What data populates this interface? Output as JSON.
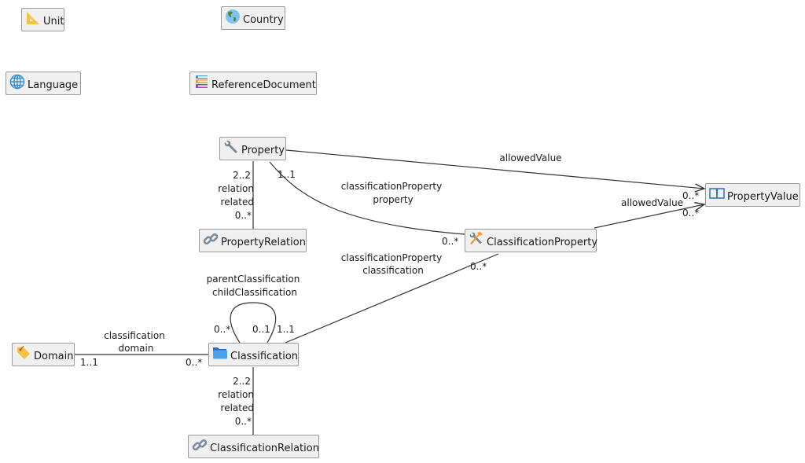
{
  "nodes": {
    "unit": {
      "label": "Unit",
      "icon": "triangle-ruler-icon"
    },
    "country": {
      "label": "Country",
      "icon": "globe-americas-icon"
    },
    "language": {
      "label": "Language",
      "icon": "globe-grid-icon"
    },
    "reference_document": {
      "label": "ReferenceDocument",
      "icon": "books-icon"
    },
    "property": {
      "label": "Property",
      "icon": "wrench-icon"
    },
    "property_relation": {
      "label": "PropertyRelation",
      "icon": "link-icon"
    },
    "property_value": {
      "label": "PropertyValue",
      "icon": "open-book-icon"
    },
    "classification_property": {
      "label": "ClassificationProperty",
      "icon": "hammer-wrench-icon"
    },
    "domain": {
      "label": "Domain",
      "icon": "tag-icon"
    },
    "classification": {
      "label": "Classification",
      "icon": "folder-icon"
    },
    "classification_relation": {
      "label": "ClassificationRelation",
      "icon": "link-icon"
    }
  },
  "edges": {
    "property_allowed_value": {
      "role": "allowedValue",
      "target_mult": "0..*"
    },
    "property_classification_property": {
      "role_a": "classificationProperty",
      "role_b": "property",
      "source_mult": "1..1",
      "target_mult": "0..*"
    },
    "property_relation": {
      "mult_a": "2..2",
      "role_a": "relation",
      "role_b": "related",
      "mult_b": "0..*"
    },
    "classification_property_allowed_value": {
      "role": "allowedValue",
      "target_mult": "0..*"
    },
    "classification_classification_property": {
      "role_a": "classificationProperty",
      "role_b": "classification",
      "source_mult": "1..1",
      "target_mult": "0..*"
    },
    "classification_self": {
      "role_a": "parentClassification",
      "role_b": "childClassification",
      "mult_a": "0..*",
      "mult_b": "0..1"
    },
    "domain_classification": {
      "role_a": "classification",
      "role_b": "domain",
      "source_mult": "1..1",
      "target_mult": "0..*"
    },
    "classification_relation": {
      "mult_a": "2..2",
      "role_a": "relation",
      "role_b": "related",
      "mult_b": "0..*"
    }
  }
}
